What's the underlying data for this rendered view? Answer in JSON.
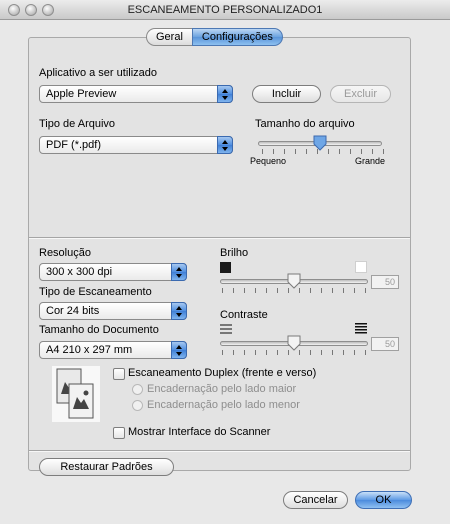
{
  "window": {
    "title": "ESCANEAMENTO PERSONALIZADO1"
  },
  "tabs": [
    {
      "label": "Geral",
      "selected": false
    },
    {
      "label": "Configurações",
      "selected": true
    }
  ],
  "app_section": {
    "label": "Aplicativo a ser utilizado",
    "selected_app": "Apple Preview",
    "add_button": "Incluir",
    "remove_button": "Excluir"
  },
  "file_type": {
    "label": "Tipo de Arquivo",
    "selected": "PDF (*.pdf)"
  },
  "file_size": {
    "label": "Tamanho do arquivo",
    "min_label": "Pequeno",
    "max_label": "Grande",
    "level_fraction": 0.5
  },
  "resolution": {
    "label": "Resolução",
    "selected": "300 x 300 dpi"
  },
  "scan_type": {
    "label": "Tipo de Escaneamento",
    "selected": "Cor 24 bits"
  },
  "doc_size": {
    "label": "Tamanho do Documento",
    "selected": "A4  210 x 297 mm"
  },
  "brightness": {
    "label": "Brilho",
    "value": "50",
    "level_fraction": 0.5
  },
  "contrast": {
    "label": "Contraste",
    "value": "50",
    "level_fraction": 0.5
  },
  "duplex": {
    "label": "Escaneamento Duplex (frente e verso)",
    "checked": false,
    "option_long": "Encadernação pelo lado maior",
    "option_short": "Encadernação pelo lado menor"
  },
  "show_interface": {
    "label": "Mostrar Interface do Scanner",
    "checked": false
  },
  "footer": {
    "restore_button": "Restaurar Padrões",
    "cancel_button": "Cancelar",
    "ok_button": "OK"
  },
  "colors": {
    "accent": "#5a94d9",
    "panel": "#e3e3e3"
  }
}
